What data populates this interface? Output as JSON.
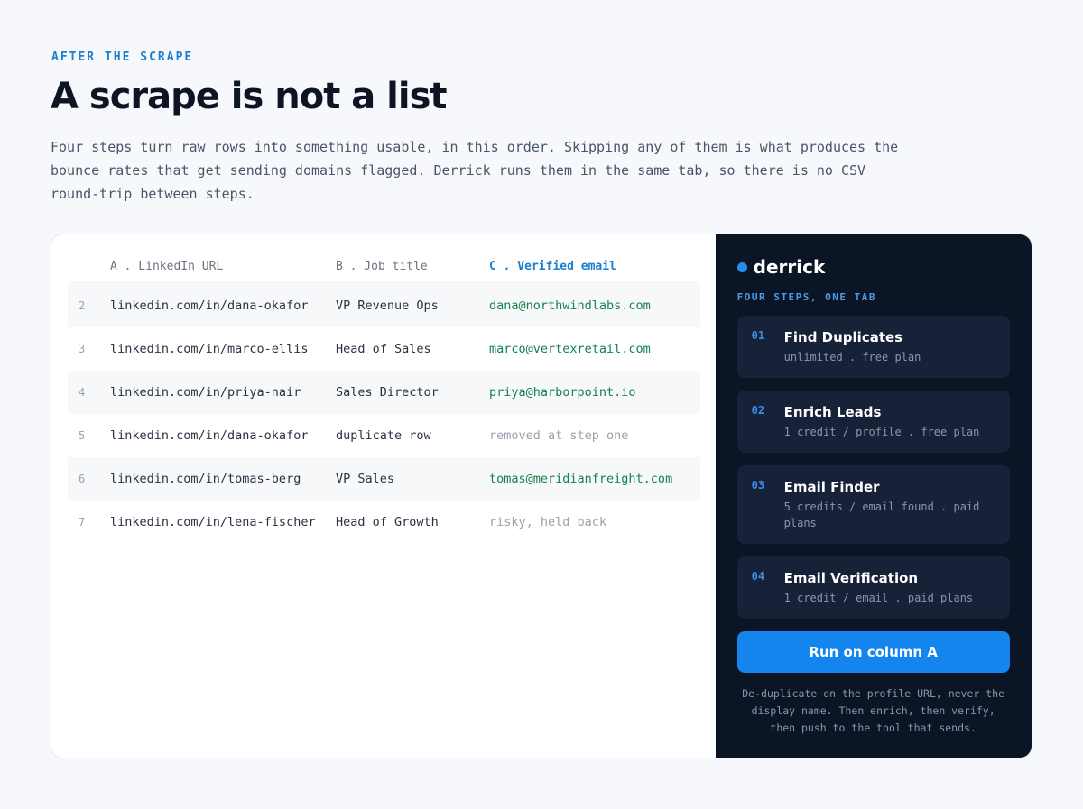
{
  "eyebrow": "AFTER THE SCRAPE",
  "headline": "A scrape is not a list",
  "intro": "Four steps turn raw rows into something usable, in this order. Skipping any of them is what produces the bounce rates that get sending domains flagged. Derrick runs them in the same tab, so there is no CSV round-trip between steps.",
  "sheet": {
    "headers": {
      "a": "A . LinkedIn URL",
      "b": "B . Job title",
      "c": "C . Verified email"
    },
    "rows": [
      {
        "num": "2",
        "url": "linkedin.com/in/dana-okafor",
        "title": "VP Revenue Ops",
        "email": "dana@northwindlabs.com"
      },
      {
        "num": "3",
        "url": "linkedin.com/in/marco-ellis",
        "title": "Head of Sales",
        "email": "marco@vertexretail.com"
      },
      {
        "num": "4",
        "url": "linkedin.com/in/priya-nair",
        "title": "Sales Director",
        "email": "priya@harborpoint.io"
      },
      {
        "num": "5",
        "url": "linkedin.com/in/dana-okafor",
        "title": "duplicate row",
        "email": "removed at step one"
      },
      {
        "num": "6",
        "url": "linkedin.com/in/tomas-berg",
        "title": "VP Sales",
        "email": "tomas@meridianfreight.com"
      },
      {
        "num": "7",
        "url": "linkedin.com/in/lena-fischer",
        "title": "Head of Growth",
        "email": "risky, held back"
      }
    ]
  },
  "panel": {
    "brand": "derrick",
    "subtitle": "FOUR STEPS, ONE TAB",
    "steps": [
      {
        "num": "01",
        "title": "Find Duplicates",
        "meta": "unlimited . free plan"
      },
      {
        "num": "02",
        "title": "Enrich Leads",
        "meta": "1 credit / profile . free plan"
      },
      {
        "num": "03",
        "title": "Email Finder",
        "meta": "5 credits / email found . paid plans"
      },
      {
        "num": "04",
        "title": "Email Verification",
        "meta": "1 credit / email . paid plans"
      }
    ],
    "run_label": "Run on column A",
    "note": "De-duplicate on the profile URL, never the display name. Then enrich, then verify, then push to the tool that sends."
  },
  "colors": {
    "accent": "#1484ee",
    "panel_bg": "#0c1526",
    "verified_email": "#15804f"
  }
}
